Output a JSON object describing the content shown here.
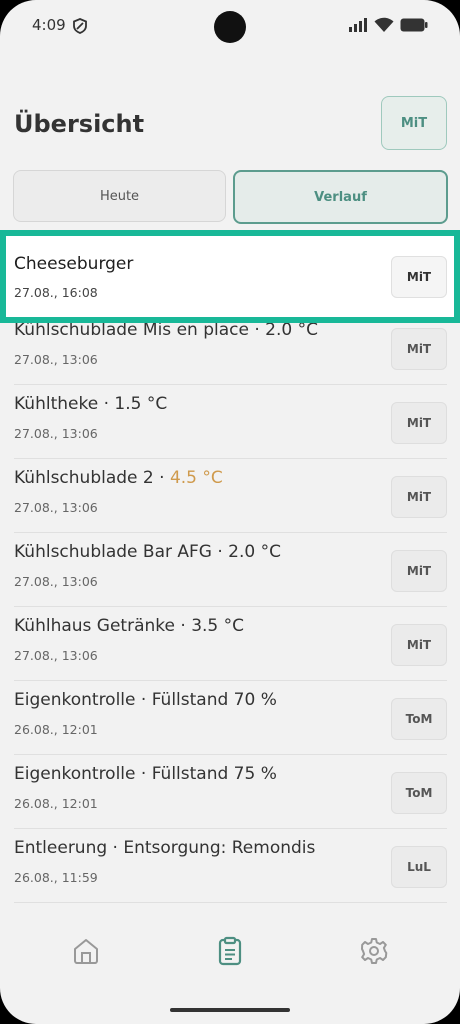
{
  "status_bar": {
    "time": "4:09",
    "icons": [
      "shield-icon",
      "signal-icon",
      "wifi-icon",
      "battery-icon"
    ]
  },
  "header": {
    "title": "Übersicht",
    "user_button_label": "MiT"
  },
  "tabs": [
    {
      "label": "Heute",
      "selected": false
    },
    {
      "label": "Verlauf",
      "selected": true
    }
  ],
  "highlighted_entry": {
    "title": "Cheeseburger",
    "timestamp": "27.08., 16:08",
    "user": "MiT"
  },
  "entries": [
    {
      "title": "Kühlschublade Mis en place · 2.0 °C",
      "timestamp": "27.08., 13:06",
      "user": "MiT"
    },
    {
      "title": "Kühltheke · 1.5 °C",
      "timestamp": "27.08., 13:06",
      "user": "MiT"
    },
    {
      "title_prefix": "Kühlschublade 2 · ",
      "title_warning": "4.5 °C",
      "timestamp": "27.08., 13:06",
      "user": "MiT"
    },
    {
      "title": "Kühlschublade Bar AFG · 2.0 °C",
      "timestamp": "27.08., 13:06",
      "user": "MiT"
    },
    {
      "title": "Kühlhaus Getränke · 3.5 °C",
      "timestamp": "27.08., 13:06",
      "user": "MiT"
    },
    {
      "title": "Eigenkontrolle · Füllstand 70 %",
      "timestamp": "26.08., 12:01",
      "user": "ToM"
    },
    {
      "title": "Eigenkontrolle · Füllstand 75 %",
      "timestamp": "26.08., 12:01",
      "user": "ToM"
    },
    {
      "title": "Entleerung · Entsorgung: Remondis",
      "timestamp": "26.08., 11:59",
      "user": "LuL"
    }
  ],
  "bottom_nav": [
    "home-icon",
    "clipboard-icon",
    "gear-icon"
  ],
  "colors": {
    "accent": "#18b898",
    "accent_dim": "#4d8f82",
    "warning": "#cf9a4c",
    "background": "#f2f2f2"
  }
}
